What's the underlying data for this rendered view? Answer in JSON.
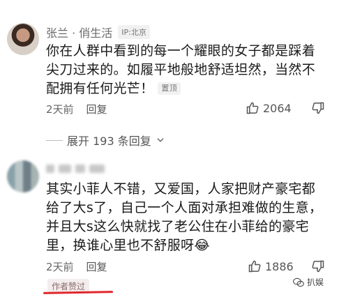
{
  "comments": [
    {
      "username": "张兰 · 俏生活",
      "ip": "IP:北京",
      "text_lines": [
        "你在人群中看到的每一个耀眼的女子都是踩着",
        "尖刀过来的。如履平地般地舒适坦然，当然不",
        "配拥有任何光芒！"
      ],
      "pinned": "置顶",
      "time": "2天前",
      "reply": "回复",
      "likes": "2064"
    },
    {
      "username": "",
      "text_lines": [
        "其实小菲人不错，又爱国，人家把财产豪宅都",
        "给了大s了，自己一个人面对承担难做的生意，",
        "并且大s这么快就找了老公住在小菲给的豪宅",
        "里，换谁心里也不舒服呀"
      ],
      "emoji": "😂",
      "time": "2天前",
      "reply": "回复",
      "likes": "1886",
      "author_badge": "作者赞过"
    }
  ],
  "expand": {
    "label": "展开 193 条回复"
  },
  "watermark": {
    "text": "扒娱"
  },
  "colors": {
    "underline": "#e0282e",
    "text": "#1a1a1a",
    "meta": "#666666"
  }
}
